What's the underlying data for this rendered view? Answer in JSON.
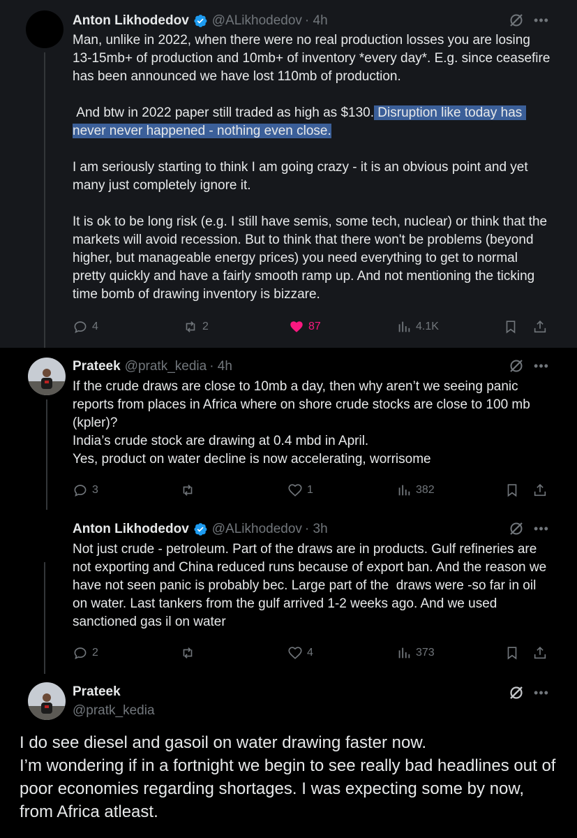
{
  "tweets": [
    {
      "name": "Anton Likhodedov",
      "handle": "@ALikhodedov",
      "time": "· 4h",
      "text_before": "Man, unlike in 2022, when there were no real production losses you are losing 13-15mb+ of production and 10mb+ of inventory *every day*. E.g. since ceasefire has been announced we have lost 110mb of production.\n\n And btw in 2022 paper still traded as high as $130.",
      "text_highlight": " Disruption like today has never never happened - nothing even close.",
      "text_after": "\n\nI am seriously starting to think I am going crazy - it is an obvious point and yet many just completely ignore it.\n\nIt is ok to be long risk (e.g. I still have semis, some tech, nuclear) or think that the markets will avoid recession. But to think that there won't be problems (beyond higher, but manageable energy prices) you need everything to get to normal pretty quickly and have a fairly smooth ramp up. And not mentioning the ticking time bomb of drawing inventory is bizzare.",
      "replies": "4",
      "reposts": "2",
      "likes": "87",
      "views": "4.1K"
    },
    {
      "name": "Prateek",
      "handle": "@pratk_kedia",
      "time": "· 4h",
      "text": "If the crude draws are close to 10mb a day, then why aren’t we seeing panic reports from places in Africa where on shore crude stocks are close to 100 mb (kpler)?\nIndia’s crude stock are drawing at 0.4 mbd in April.\nYes, product on water decline is now accelerating, worrisome",
      "replies": "3",
      "reposts": "",
      "likes": "1",
      "views": "382"
    },
    {
      "name": "Anton Likhodedov",
      "handle": "@ALikhodedov",
      "time": "· 3h",
      "text": "Not just crude - petroleum. Part of the draws are in products. Gulf refineries are not exporting and China reduced runs because of export ban. And the reason we have not seen panic is probably bec. Large part of the  draws were -so far in oil on water. Last tankers from the gulf arrived 1-2 weeks ago. And we used sanctioned gas il on water",
      "replies": "2",
      "reposts": "",
      "likes": "4",
      "views": "373"
    }
  ],
  "main_tweet": {
    "name": "Prateek",
    "handle": "@pratk_kedia",
    "text": "I do see diesel and gasoil on water drawing faster now.\nI’m wondering if in a fortnight we begin to see really bad headlines out of poor economies regarding shortages. I was expecting some by now, from Africa atleast."
  },
  "icons": {
    "verified": "verified-badge-icon",
    "grok": "grok-icon",
    "more": "more-icon",
    "reply": "reply-icon",
    "repost": "repost-icon",
    "like": "heart-icon",
    "views": "views-icon",
    "bookmark": "bookmark-icon",
    "share": "share-icon"
  },
  "colors": {
    "background": "#000000",
    "highlighted_tweet_bg": "#16181c",
    "text": "#e7e9ea",
    "muted": "#71767b",
    "like": "#f91880",
    "verified": "#1d9bf0",
    "selection": "#3b5f99"
  }
}
